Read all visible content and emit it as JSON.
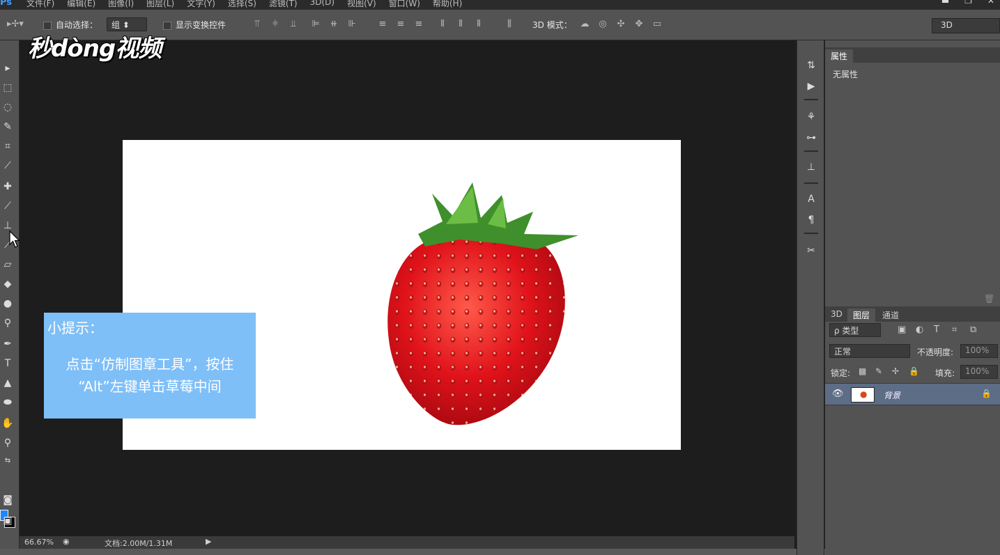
{
  "menu": {
    "app": "Ps",
    "items": [
      "文件(F)",
      "编辑(E)",
      "图像(I)",
      "图层(L)",
      "文字(Y)",
      "选择(S)",
      "滤镜(T)",
      "3D(D)",
      "视图(V)",
      "窗口(W)",
      "帮助(H)"
    ],
    "window_controls": [
      "▬",
      "❐",
      "✕"
    ]
  },
  "options": {
    "auto_select_label": "自动选择：",
    "auto_select_value": "组",
    "show_transform_label": "显示变换控件",
    "mode3d_label": "3D 模式：",
    "workspace_value": "3D"
  },
  "watermark": "秒dòng视频",
  "tip": {
    "title": "小提示：",
    "line1": "点击“仿制图章工具”，按住",
    "line2": "“Alt”左键单击草莓中间"
  },
  "status": {
    "zoom": "66.67%",
    "doc": "文档:2.00M/1.31M"
  },
  "properties": {
    "tab": "属性",
    "content": "无属性"
  },
  "layers": {
    "tabs": [
      "3D",
      "图层",
      "通道"
    ],
    "filter": "ρ 类型",
    "blend": "正常",
    "opacity_label": "不透明度:",
    "opacity": "100%",
    "lock_label": "锁定:",
    "fill_label": "填充:",
    "fill": "100%",
    "layer_name": "背景"
  },
  "colors": {
    "foreground": "#1e86ff",
    "background": "#000000",
    "accent": "#7fbff8"
  }
}
